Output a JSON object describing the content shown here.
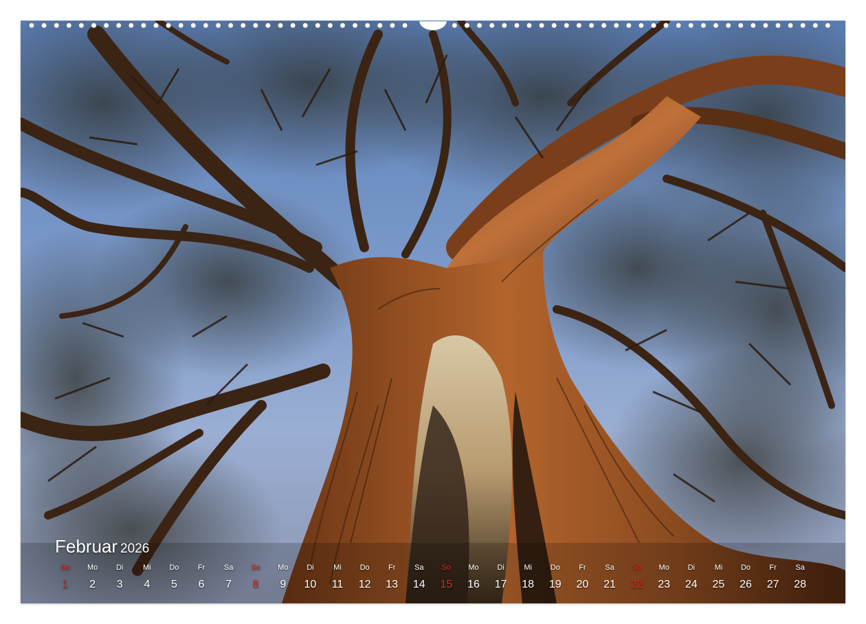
{
  "calendar": {
    "month": "Februar",
    "year": "2026",
    "days": [
      {
        "wd": "So",
        "n": "1",
        "sun": true
      },
      {
        "wd": "Mo",
        "n": "2"
      },
      {
        "wd": "Di",
        "n": "3"
      },
      {
        "wd": "Mi",
        "n": "4"
      },
      {
        "wd": "Do",
        "n": "5"
      },
      {
        "wd": "Fr",
        "n": "6"
      },
      {
        "wd": "Sa",
        "n": "7"
      },
      {
        "wd": "So",
        "n": "8",
        "sun": true
      },
      {
        "wd": "Mo",
        "n": "9"
      },
      {
        "wd": "Di",
        "n": "10"
      },
      {
        "wd": "Mi",
        "n": "11"
      },
      {
        "wd": "Do",
        "n": "12"
      },
      {
        "wd": "Fr",
        "n": "13"
      },
      {
        "wd": "Sa",
        "n": "14"
      },
      {
        "wd": "So",
        "n": "15",
        "sun": true
      },
      {
        "wd": "Mo",
        "n": "16"
      },
      {
        "wd": "Di",
        "n": "17"
      },
      {
        "wd": "Mi",
        "n": "18"
      },
      {
        "wd": "Do",
        "n": "19"
      },
      {
        "wd": "Fr",
        "n": "20"
      },
      {
        "wd": "Sa",
        "n": "21"
      },
      {
        "wd": "So",
        "n": "22",
        "sun": true
      },
      {
        "wd": "Mo",
        "n": "23"
      },
      {
        "wd": "Di",
        "n": "24"
      },
      {
        "wd": "Mi",
        "n": "25"
      },
      {
        "wd": "Do",
        "n": "26"
      },
      {
        "wd": "Fr",
        "n": "27"
      },
      {
        "wd": "Sa",
        "n": "28"
      }
    ]
  },
  "colors": {
    "sunday": "#e8231b",
    "text": "#ffffff",
    "sky": "#7d9bcb",
    "bark": "#a0582a"
  },
  "photo": {
    "subject": "tree-trunk-from-below"
  }
}
